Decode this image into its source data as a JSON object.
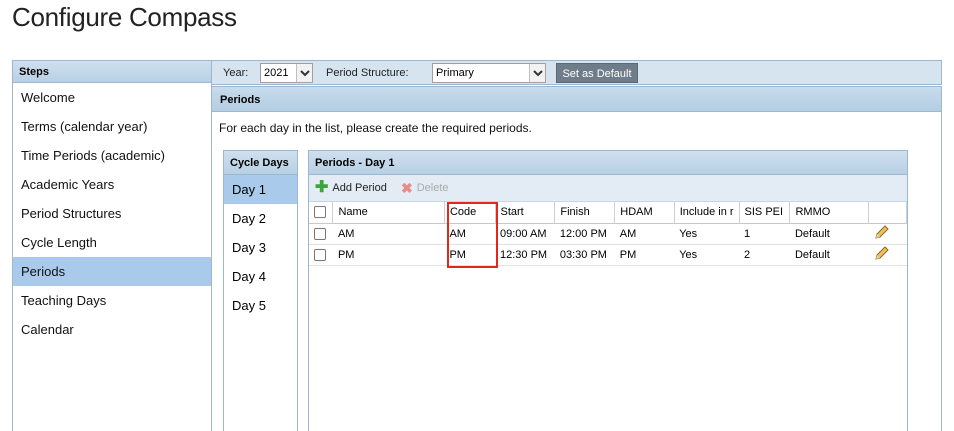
{
  "page_title": "Configure Compass",
  "steps": {
    "header": "Steps",
    "items": [
      {
        "label": "Welcome"
      },
      {
        "label": "Terms (calendar year)"
      },
      {
        "label": "Time Periods (academic)"
      },
      {
        "label": "Academic Years"
      },
      {
        "label": "Period Structures"
      },
      {
        "label": "Cycle Length"
      },
      {
        "label": "Periods",
        "active": true
      },
      {
        "label": "Teaching Days"
      },
      {
        "label": "Calendar"
      }
    ]
  },
  "toolbar": {
    "year_label": "Year:",
    "year_value": "2021",
    "period_structure_label": "Period Structure:",
    "period_structure_value": "Primary",
    "set_default_label": "Set as Default"
  },
  "periods": {
    "header": "Periods",
    "instruction": "For each day in the list, please create the required periods."
  },
  "cycle_days": {
    "header": "Cycle Days",
    "days": [
      "Day 1",
      "Day 2",
      "Day 3",
      "Day 4",
      "Day 5"
    ],
    "selected": "Day 1"
  },
  "grid": {
    "title": "Periods - Day 1",
    "add_label": "Add Period",
    "delete_label": "Delete",
    "columns": [
      "Name",
      "Code",
      "Start",
      "Finish",
      "HDAM",
      "Include in r",
      "SIS PEI",
      "RMMO"
    ],
    "rows": [
      [
        "AM",
        "AM",
        "09:00 AM",
        "12:00 PM",
        "AM",
        "Yes",
        "1",
        "Default"
      ],
      [
        "PM",
        "PM",
        "12:30 PM",
        "03:30 PM",
        "PM",
        "Yes",
        "2",
        "Default"
      ]
    ]
  },
  "colors": {
    "accent_selected": "#a9caea",
    "header_blue": "#b8d0e4",
    "highlight_box": "#e0281c",
    "add_icon": "#3da33d"
  }
}
